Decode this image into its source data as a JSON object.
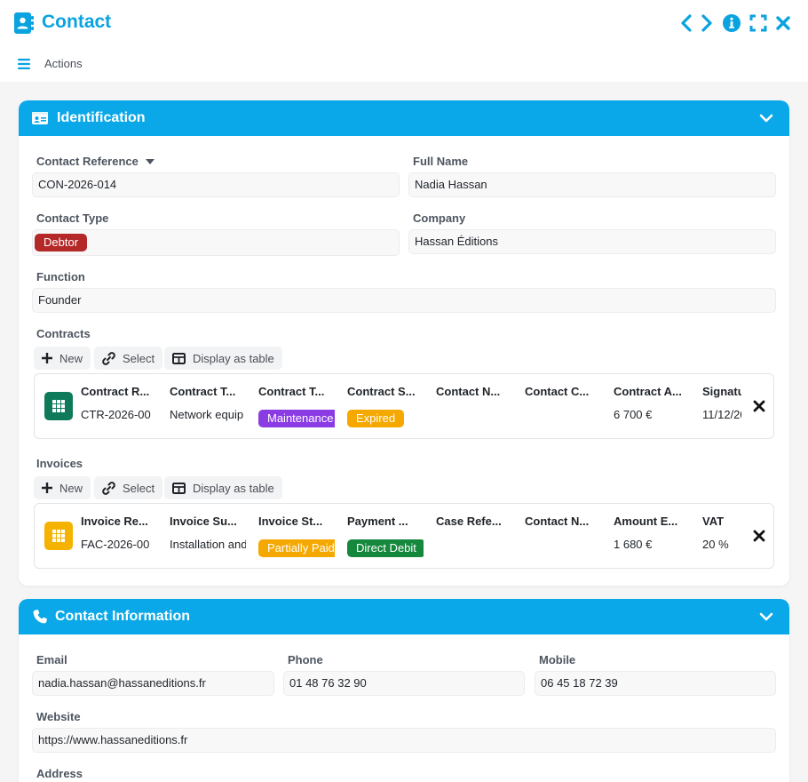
{
  "header": {
    "title": "Contact",
    "actions_label": "Actions"
  },
  "identification": {
    "title": "Identification",
    "contact_reference_label": "Contact Reference",
    "contact_reference_value": "CON-2026-014",
    "full_name_label": "Full Name",
    "full_name_value": "Nadia Hassan",
    "contact_type_label": "Contact Type",
    "contact_type_value": "Debtor",
    "company_label": "Company",
    "company_value": "Hassan Éditions",
    "function_label": "Function",
    "function_value": "Founder",
    "contracts": {
      "label": "Contracts",
      "new_label": "New",
      "select_label": "Select",
      "table_label": "Display as table",
      "columns": [
        "Contract R...",
        "Contract T...",
        "Contract T...",
        "Contract S...",
        "Contact N...",
        "Contact C...",
        "Contract A...",
        "Signatu"
      ],
      "row": {
        "reference": "CTR-2026-00",
        "title": "Network equip",
        "type": "Maintenance",
        "status": "Expired",
        "contact_name": "",
        "contact_company": "",
        "amount": "6 700 €",
        "signature": "11/12/20"
      }
    },
    "invoices": {
      "label": "Invoices",
      "new_label": "New",
      "select_label": "Select",
      "table_label": "Display as table",
      "columns": [
        "Invoice Re...",
        "Invoice Su...",
        "Invoice St...",
        "Payment ...",
        "Case Refe...",
        "Contact N...",
        "Amount E...",
        "VAT"
      ],
      "row": {
        "reference": "FAC-2026-00",
        "subject": "Installation and",
        "status": "Partially Paid",
        "payment": "Direct Debit",
        "case_ref": "",
        "contact_name": "",
        "amount": "1 680 €",
        "vat": "20 %"
      }
    }
  },
  "contact_information": {
    "title": "Contact Information",
    "email_label": "Email",
    "email_value": "nadia.hassan@hassaneditions.fr",
    "phone_label": "Phone",
    "phone_value": "01 48 76 32 90",
    "mobile_label": "Mobile",
    "mobile_value": "06 45 18 72 39",
    "website_label": "Website",
    "website_value": "https://www.hassaneditions.fr",
    "address_label": "Address"
  },
  "colors": {
    "accent": "#0aa8e8",
    "debtor": "#b42828",
    "maintenance": "#8a3be3",
    "expired": "#f5a800",
    "partially_paid": "#f5a800",
    "direct_debit": "#15883d",
    "contracts_icon": "#0f7a5a",
    "invoices_icon": "#f5b300"
  },
  "icons": {
    "title": "address-book-icon",
    "prev": "chevron-left-icon",
    "next": "chevron-right-icon",
    "info": "info-icon",
    "fullscreen": "expand-icon",
    "close": "close-icon",
    "menu": "hamburger-icon",
    "identification": "id-card-icon",
    "contact": "phone-icon"
  }
}
